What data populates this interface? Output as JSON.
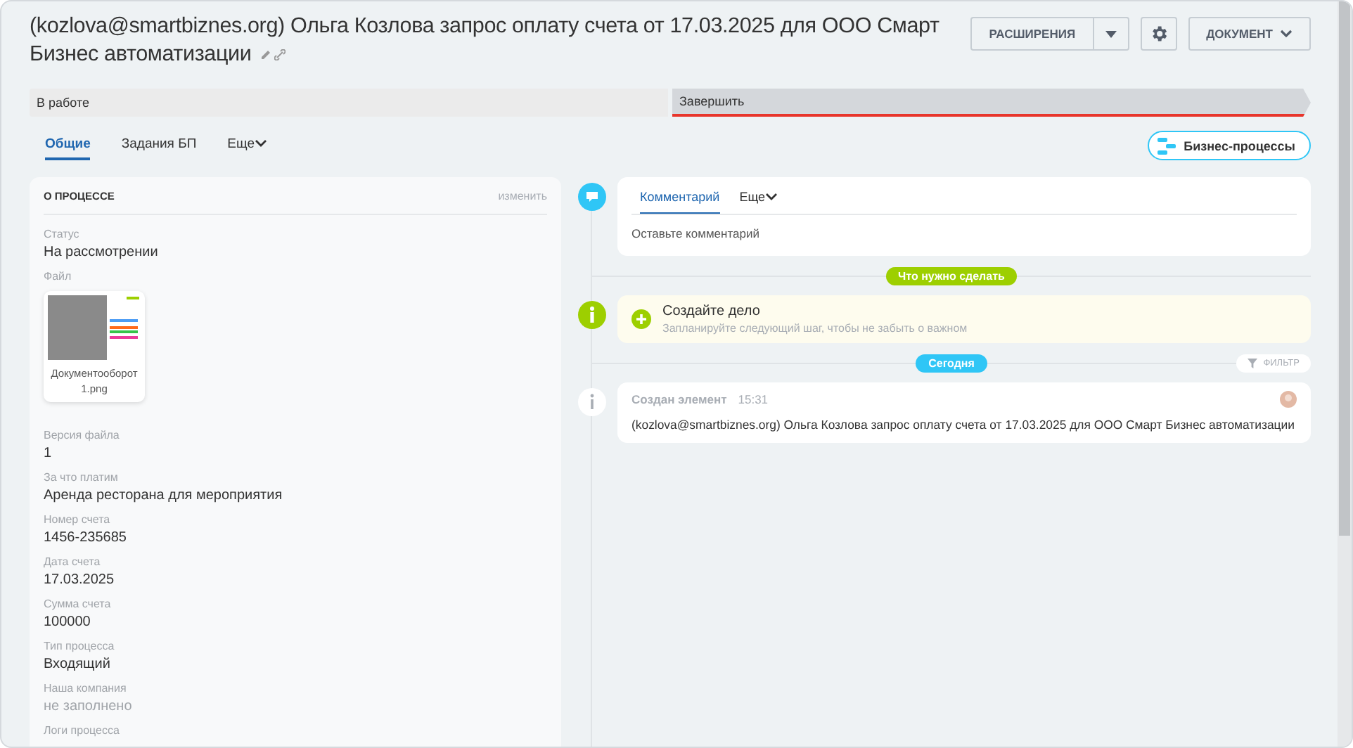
{
  "header": {
    "title": "(kozlova@smartbiznes.org) Ольга Козлова запрос оплату счета от 17.03.2025 для ООО Смарт Бизнес автоматизации",
    "buttons": [
      {
        "kind": "split",
        "label": "РАСШИРЕНИЯ"
      },
      {
        "kind": "gear"
      },
      {
        "kind": "dropdown",
        "label": "ДОКУМЕНТ"
      }
    ]
  },
  "stages": [
    {
      "label": "В работе",
      "kind": "current"
    },
    {
      "label": "Завершить",
      "kind": "final"
    }
  ],
  "tabs": [
    {
      "label": "Общие",
      "selected": true,
      "kind": "tab"
    },
    {
      "label": "Задания БП",
      "selected": false,
      "kind": "tab"
    },
    {
      "label": "Еще",
      "selected": false,
      "kind": "menu"
    }
  ],
  "bp_button": "Бизнес-процессы",
  "about": {
    "title": "О ПРОЦЕССЕ",
    "edit": "изменить",
    "fields": [
      {
        "label": "Статус",
        "value": "На рассмотрении",
        "kind": "text"
      },
      {
        "label": "Файл",
        "value": "Документооборот 1.png",
        "kind": "file"
      },
      {
        "label": "Версия файла",
        "value": "1",
        "kind": "text"
      },
      {
        "label": "За что платим",
        "value": "Аренда ресторана для мероприятия",
        "kind": "text"
      },
      {
        "label": "Номер счета",
        "value": "1456-235685",
        "kind": "text"
      },
      {
        "label": "Дата счета",
        "value": "17.03.2025",
        "kind": "text"
      },
      {
        "label": "Сумма счета",
        "value": "100000",
        "kind": "text"
      },
      {
        "label": "Тип процесса",
        "value": "Входящий",
        "kind": "text"
      },
      {
        "label": "Наша компания",
        "value": "не заполнено",
        "kind": "empty"
      },
      {
        "label": "Логи процесса"
      }
    ]
  },
  "editor": {
    "tabs": [
      {
        "label": "Комментарий",
        "selected": true,
        "kind": "tab"
      },
      {
        "label": "Еще",
        "selected": false,
        "kind": "menu"
      }
    ],
    "placeholder": "Оставьте комментарий"
  },
  "todo_divider": "Что нужно сделать",
  "todo": {
    "title": "Создайте дело",
    "subtitle": "Запланируйте следующий шаг, чтобы не забыть о важном"
  },
  "today_divider": "Сегодня",
  "filter": "ФИЛЬТР",
  "events": [
    {
      "title": "Создан элемент",
      "time": "15:31",
      "text": "(kozlova@smartbiznes.org) Ольга Козлова запрос оплату счета от 17.03.2025 для ООО Смарт Бизнес автоматизации"
    }
  ]
}
